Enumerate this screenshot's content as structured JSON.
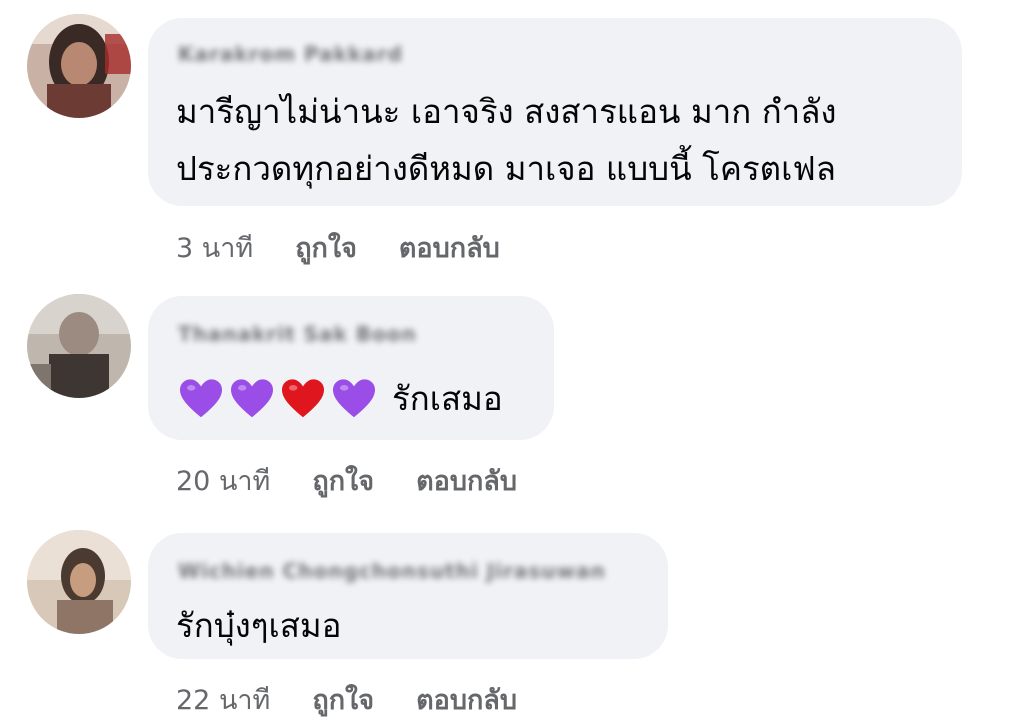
{
  "comments": [
    {
      "author": "Karakrom Pakkard",
      "text_lines": [
        "มารีญาไม่น่านะ เอาจริง สงสารแอน มาก กำลัง",
        "ประกวดทุกอย่างดีหมด มาเจอ แบบนี้ โครตเฟล"
      ],
      "time": "3 นาที",
      "like_label": "ถูกใจ",
      "reply_label": "ตอบกลับ"
    },
    {
      "author": "Thanakrit Sak Boon",
      "hearts": [
        "purple-heart-icon",
        "purple-heart-icon",
        "red-heart-icon",
        "purple-heart-icon"
      ],
      "text": "รักเสมอ",
      "time": "20 นาที",
      "like_label": "ถูกใจ",
      "reply_label": "ตอบกลับ"
    },
    {
      "author": "Wichien Chongchonsuthi Jirasuwan",
      "text": "รักบุ๋งๆเสมอ",
      "time": "22 นาที",
      "like_label": "ถูกใจ",
      "reply_label": "ตอบกลับ"
    }
  ],
  "colors": {
    "bubble": "#f0f2f5",
    "text": "#050505",
    "secondary": "#65676b",
    "purple_heart": "#9b4de8",
    "red_heart": "#e0161f"
  }
}
